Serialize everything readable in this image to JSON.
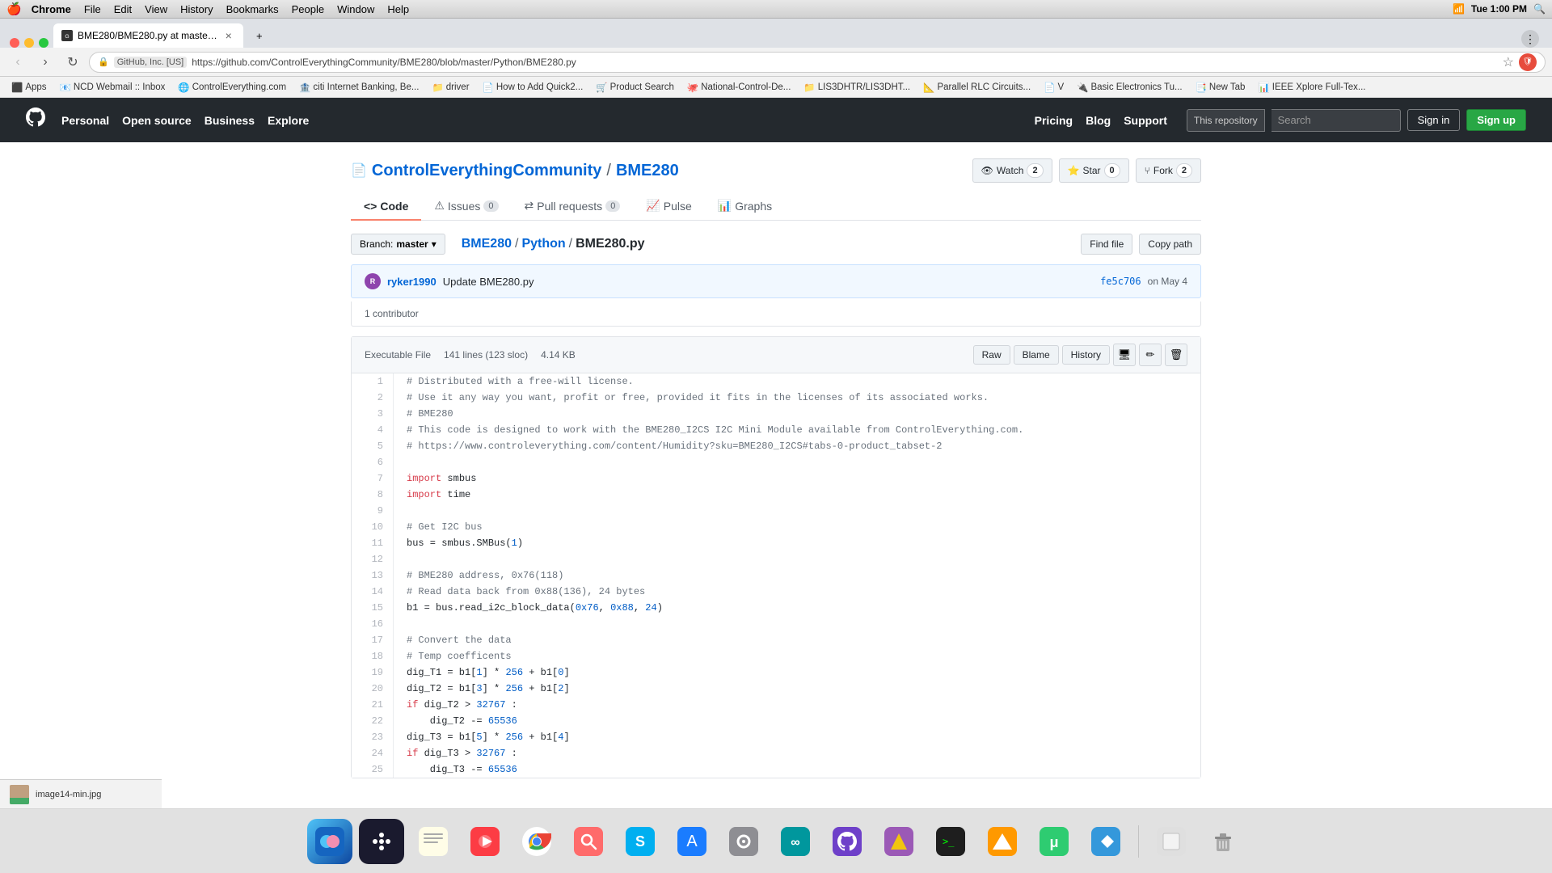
{
  "menubar": {
    "apple": "🍎",
    "items": [
      "Chrome",
      "File",
      "Edit",
      "View",
      "History",
      "Bookmarks",
      "People",
      "Window",
      "Help"
    ],
    "bold_item": "Chrome",
    "time": "Tue 1:00 PM"
  },
  "tab": {
    "title": "BME280/BME280.py at maste…",
    "favicon": "⬛"
  },
  "address_bar": {
    "lock": "🔒",
    "badge": "GitHub, Inc. [US]",
    "url": "https://github.com/ControlEverythingCommunity/BME280/blob/master/Python/BME280.py"
  },
  "bookmarks": [
    {
      "icon": "⬛",
      "label": "Apps"
    },
    {
      "icon": "📧",
      "label": "NCD Webmail :: Inbox"
    },
    {
      "icon": "🌐",
      "label": "ControlEverything.com"
    },
    {
      "icon": "🏦",
      "label": "citi Internet Banking, Be..."
    },
    {
      "icon": "💾",
      "label": "driver"
    },
    {
      "icon": "📄",
      "label": "How to Add Quick2..."
    },
    {
      "icon": "🛒",
      "label": "Product Search"
    },
    {
      "icon": "🐙",
      "label": "National-Control-De..."
    },
    {
      "icon": "📁",
      "label": "LIS3DHTR/LIS3DHT..."
    },
    {
      "icon": "📐",
      "label": "Parallel RLC Circuits..."
    },
    {
      "icon": "📄",
      "label": "V"
    },
    {
      "icon": "🔌",
      "label": "Basic Electronics Tu..."
    },
    {
      "icon": "📑",
      "label": "New Tab"
    },
    {
      "icon": "📊",
      "label": "IEEE Xplore Full-Tex..."
    }
  ],
  "github": {
    "nav": [
      "Personal",
      "Open source",
      "Business",
      "Explore"
    ],
    "search_scope": "This repository",
    "search_placeholder": "Search",
    "signin": "Sign in",
    "signup": "Sign up",
    "pricing": "Pricing",
    "blog": "Blog",
    "support": "Support"
  },
  "repo": {
    "icon": "📄",
    "org": "ControlEverythingCommunity",
    "name": "BME280",
    "watch_label": "Watch",
    "watch_count": "2",
    "star_label": "Star",
    "star_count": "0",
    "fork_label": "Fork",
    "fork_count": "2"
  },
  "tabs": [
    {
      "label": "Code",
      "icon": "◈",
      "active": true
    },
    {
      "label": "Issues",
      "count": "0"
    },
    {
      "label": "Pull requests",
      "count": "0"
    },
    {
      "label": "Pulse"
    },
    {
      "label": "Graphs"
    }
  ],
  "file": {
    "branch": "master",
    "breadcrumb": [
      "BME280",
      "Python",
      "BME280.py"
    ],
    "find_file": "Find file",
    "copy_path": "Copy path",
    "commit_author": "ryker1990",
    "commit_msg": "Update BME280.py",
    "commit_hash": "fe5c706",
    "commit_date": "on May 4",
    "contributors": "1 contributor",
    "file_type": "Executable File",
    "lines": "141 lines (123 sloc)",
    "size": "4.14 KB",
    "raw": "Raw",
    "blame": "Blame",
    "history": "History"
  },
  "code_lines": [
    {
      "n": 1,
      "text": "# Distributed with a free-will license.",
      "type": "comment"
    },
    {
      "n": 2,
      "text": "# Use it any way you want, profit or free, provided it fits in the licenses of its associated works.",
      "type": "comment"
    },
    {
      "n": 3,
      "text": "# BME280",
      "type": "comment"
    },
    {
      "n": 4,
      "text": "# This code is designed to work with the BME280_I2CS I2C Mini Module available from ControlEverything.com.",
      "type": "comment"
    },
    {
      "n": 5,
      "text": "# https://www.controleverything.com/content/Humidity?sku=BME280_I2CS#tabs-0-product_tabset-2",
      "type": "comment"
    },
    {
      "n": 6,
      "text": "",
      "type": "blank"
    },
    {
      "n": 7,
      "text": "import smbus",
      "type": "code"
    },
    {
      "n": 8,
      "text": "import time",
      "type": "code"
    },
    {
      "n": 9,
      "text": "",
      "type": "blank"
    },
    {
      "n": 10,
      "text": "# Get I2C bus",
      "type": "comment"
    },
    {
      "n": 11,
      "text": "bus = smbus.SMBus(1)",
      "type": "code"
    },
    {
      "n": 12,
      "text": "",
      "type": "blank"
    },
    {
      "n": 13,
      "text": "# BME280 address, 0x76(118)",
      "type": "comment"
    },
    {
      "n": 14,
      "text": "# Read data back from 0x88(136), 24 bytes",
      "type": "comment"
    },
    {
      "n": 15,
      "text": "b1 = bus.read_i2c_block_data(0x76, 0x88, 24)",
      "type": "code_highlight"
    },
    {
      "n": 16,
      "text": "",
      "type": "blank"
    },
    {
      "n": 17,
      "text": "# Convert the data",
      "type": "comment"
    },
    {
      "n": 18,
      "text": "# Temp coefficents",
      "type": "comment"
    },
    {
      "n": 19,
      "text": "dig_T1 = b1[1] * 256 + b1[0]",
      "type": "code_highlight"
    },
    {
      "n": 20,
      "text": "dig_T2 = b1[3] * 256 + b1[2]",
      "type": "code_highlight"
    },
    {
      "n": 21,
      "text": "if dig_T2 > 32767 :",
      "type": "code"
    },
    {
      "n": 22,
      "text": "    dig_T2 -= 65536",
      "type": "code_highlight"
    },
    {
      "n": 23,
      "text": "dig_T3 = b1[5] * 256 + b1[4]",
      "type": "code_highlight"
    },
    {
      "n": 24,
      "text": "if dig_T3 > 32767 :",
      "type": "code"
    },
    {
      "n": 25,
      "text": "    dig_T3 -= 65536",
      "type": "code_highlight"
    }
  ],
  "dock_items": [
    {
      "icon": "🔵",
      "label": "finder",
      "color": "#1a7cff"
    },
    {
      "icon": "🚀",
      "label": "launchpad",
      "color": "#999"
    },
    {
      "icon": "📝",
      "label": "notes",
      "color": "#fff"
    },
    {
      "icon": "🎵",
      "label": "music",
      "color": "#fc3c44"
    },
    {
      "icon": "🔵",
      "label": "chrome",
      "color": "#4285f4"
    },
    {
      "icon": "🔍",
      "label": "search",
      "color": "#ff6b6b"
    },
    {
      "icon": "🔷",
      "label": "skype",
      "color": "#00aff0"
    },
    {
      "icon": "🅰",
      "label": "appstore",
      "color": "#1a7cff"
    },
    {
      "icon": "⚙️",
      "label": "systemprefs",
      "color": "#999"
    },
    {
      "icon": "🔌",
      "label": "arduino",
      "color": "#00979d"
    },
    {
      "icon": "🐱",
      "label": "github",
      "color": "#333"
    },
    {
      "icon": "⭐",
      "label": "reeder",
      "color": "#9b59b6"
    },
    {
      "icon": "💻",
      "label": "terminal",
      "color": "#333"
    },
    {
      "icon": "🔶",
      "label": "vlc",
      "color": "#ff8800"
    },
    {
      "icon": "🟢",
      "label": "utorrent",
      "color": "#27ae60"
    },
    {
      "icon": "🔵",
      "label": "copyflow",
      "color": "#3498db"
    }
  ],
  "download": {
    "filename": "image14-min.jpg"
  }
}
